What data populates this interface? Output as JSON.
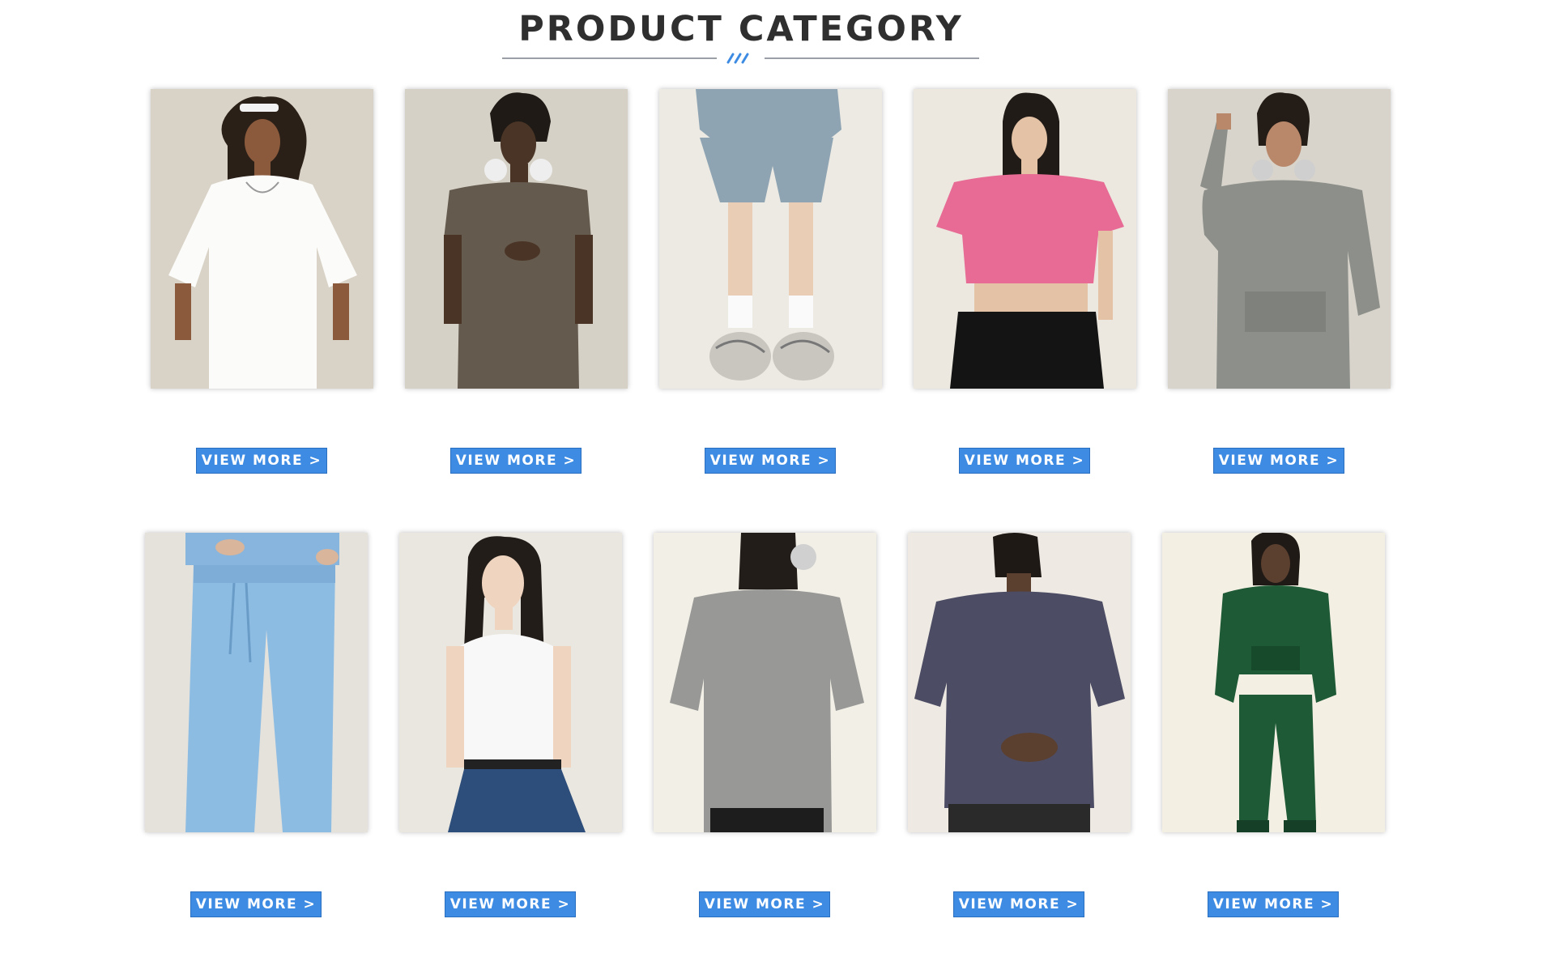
{
  "header": {
    "title": "PRODUCT CATEGORY"
  },
  "colors": {
    "accent": "#3d8be3",
    "title": "#2f2f2f",
    "divider": "#9aa0a6"
  },
  "products": [
    {
      "image": "model-white-oversized-tee",
      "button_label": "VIEW MORE >"
    },
    {
      "image": "model-brown-sleeveless-tee",
      "button_label": "VIEW MORE >"
    },
    {
      "image": "model-grey-blue-shorts",
      "button_label": "VIEW MORE >"
    },
    {
      "image": "model-pink-crop-tee",
      "button_label": "VIEW MORE >"
    },
    {
      "image": "model-grey-hoodie",
      "button_label": "VIEW MORE >"
    },
    {
      "image": "model-light-blue-sweatpants",
      "button_label": "VIEW MORE >"
    },
    {
      "image": "model-white-tank-top",
      "button_label": "VIEW MORE >"
    },
    {
      "image": "model-grey-washed-tee-back",
      "button_label": "VIEW MORE >"
    },
    {
      "image": "model-navy-tee-back",
      "button_label": "VIEW MORE >"
    },
    {
      "image": "model-green-hoodie-set",
      "button_label": "VIEW MORE >"
    }
  ]
}
